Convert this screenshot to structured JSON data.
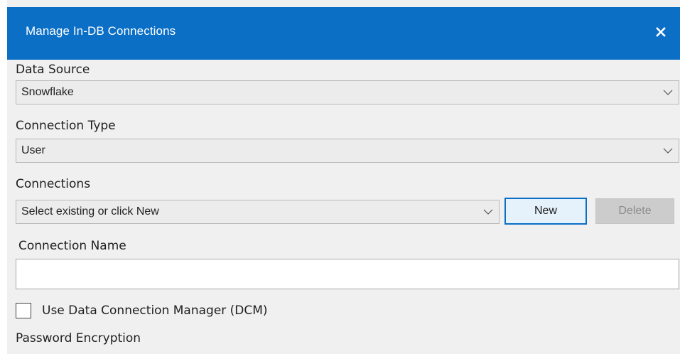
{
  "window": {
    "title": "Manage In-DB Connections",
    "close_glyph": "X",
    "accent_color": "#0b6fc6"
  },
  "data_source": {
    "label": "Data Source",
    "selected": "Snowflake"
  },
  "connection_type": {
    "label": "Connection Type",
    "selected": "User"
  },
  "connections": {
    "label": "Connections",
    "selected": "Select existing or click New",
    "new_label": "New",
    "delete_label": "Delete"
  },
  "connection_name": {
    "label": "Connection Name",
    "value": ""
  },
  "dcm": {
    "label": "Use Data Connection Manager (DCM)",
    "checked": false
  },
  "password_encryption": {
    "label": "Password Encryption"
  }
}
